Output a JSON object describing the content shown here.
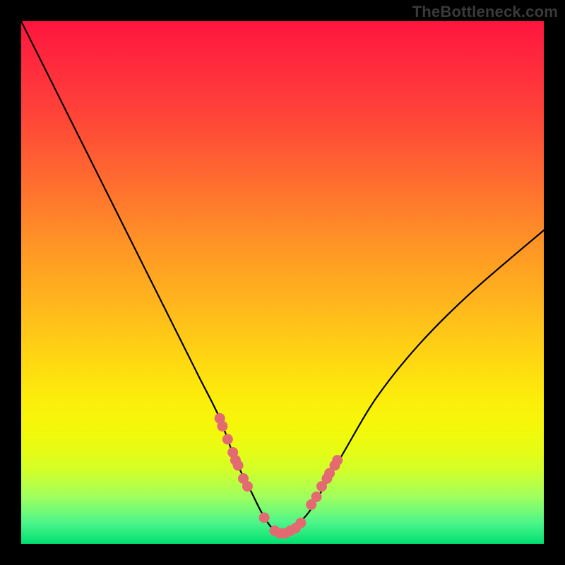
{
  "watermark": "TheBottleneck.com",
  "chart_data": {
    "type": "line",
    "title": "",
    "xlabel": "",
    "ylabel": "",
    "xlim": [
      0,
      100
    ],
    "ylim": [
      0,
      100
    ],
    "series": [
      {
        "name": "curve",
        "x": [
          0,
          6,
          12,
          18,
          24,
          30,
          34,
          38,
          41,
          44,
          46,
          48,
          50,
          52,
          55,
          58,
          62,
          68,
          76,
          86,
          100
        ],
        "y": [
          100,
          88,
          76,
          64,
          52,
          40,
          32,
          24,
          16,
          10,
          6,
          3,
          2,
          3,
          6,
          11,
          18,
          28,
          38,
          48,
          60
        ]
      }
    ],
    "highlighted_points": {
      "name": "scatter-points",
      "color": "#e46a72",
      "x": [
        38.0,
        38.5,
        39.5,
        40.5,
        41.0,
        41.5,
        42.5,
        43.3,
        46.5,
        48.5,
        49.5,
        50.5,
        51.5,
        52.5,
        53.5,
        55.5,
        56.5,
        57.5,
        58.5,
        59.0,
        60.0,
        60.5
      ],
      "y": [
        24.0,
        22.5,
        20.0,
        17.5,
        16.0,
        15.0,
        12.5,
        11.0,
        5.0,
        2.5,
        2.0,
        2.0,
        2.5,
        3.0,
        4.0,
        7.5,
        9.0,
        11.0,
        12.5,
        13.5,
        15.0,
        16.0
      ]
    }
  }
}
